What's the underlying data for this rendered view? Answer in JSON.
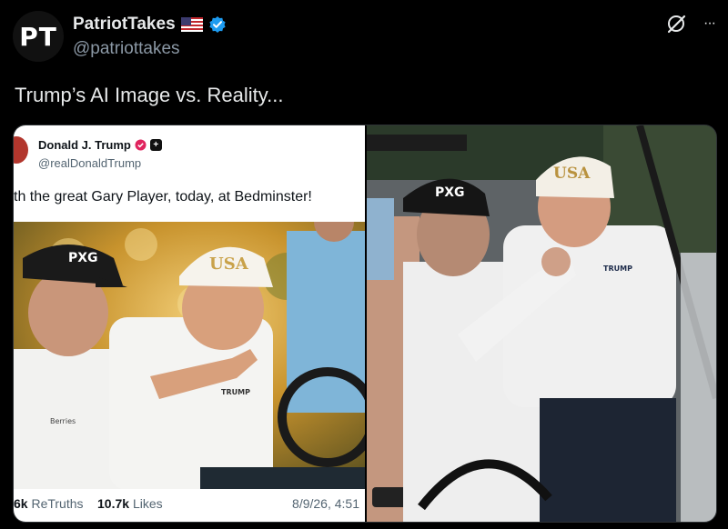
{
  "author": {
    "avatar_initials": "PT",
    "display_name": "PatriotTakes",
    "handle": "@patriottakes",
    "flag_icon": "us-flag-icon",
    "verified_icon": "verified-badge-icon"
  },
  "header_icons": {
    "grok": "grok-slash-icon",
    "more": "more-options-icon",
    "more_text": "···"
  },
  "tweet": {
    "text": "Trump’s AI Image vs. Reality..."
  },
  "embedded_post": {
    "display_name": "Donald J. Trump",
    "handle": "@realDonaldTrump",
    "text": "th the great Gary Player, today, at Bedminster!",
    "stats": {
      "retruths_count": "6k",
      "retruths_label": "ReTruths",
      "likes_count": "10.7k",
      "likes_label": "Likes",
      "timestamp": "8/9/26, 4:51"
    },
    "image_text": {
      "hat_left": "PXG",
      "hat_right": "USA",
      "shirt_right": "TRUMP",
      "shirt_left": "Berries"
    }
  },
  "reality_photo": {
    "hat_left": "PXG",
    "hat_right": "USA",
    "shirt_right": "TRUMP"
  },
  "colors": {
    "background": "#000000",
    "verified": "#1d9bf0",
    "secondary_text": "#8b98a5"
  }
}
